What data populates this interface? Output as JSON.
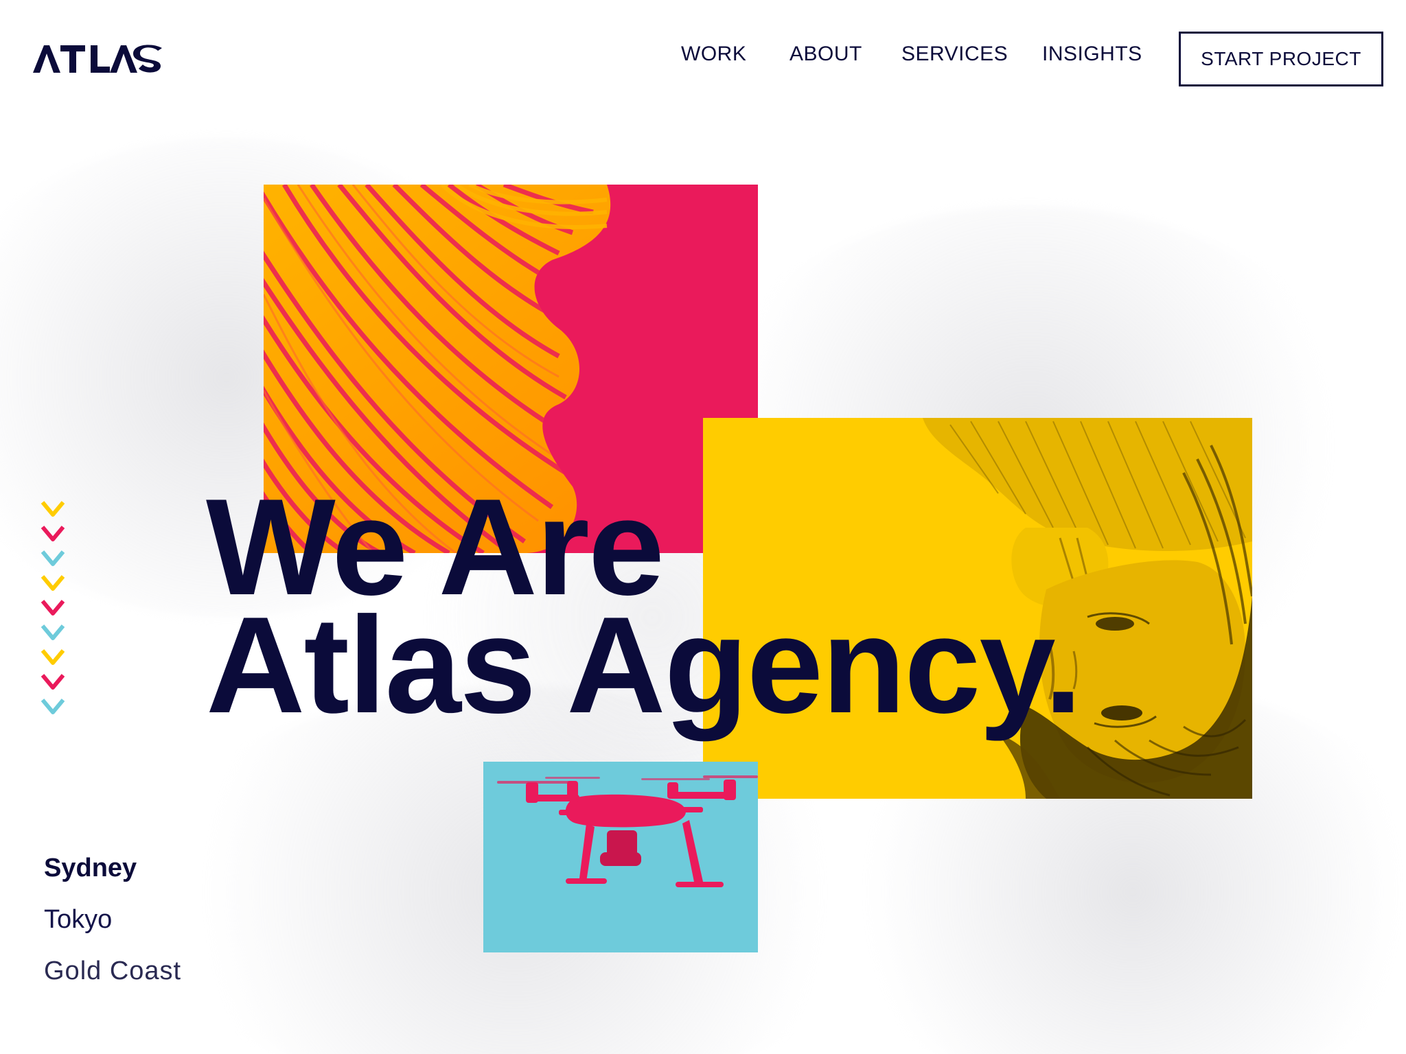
{
  "brand": {
    "logo_text": "ATLAS"
  },
  "nav": {
    "items": [
      {
        "label": "WORK"
      },
      {
        "label": "ABOUT"
      },
      {
        "label": "SERVICES"
      },
      {
        "label": "INSIGHTS"
      }
    ],
    "cta_label": "START PROJECT"
  },
  "hero": {
    "line1": "We Are",
    "line2": "Atlas Agency."
  },
  "locations": [
    {
      "name": "Sydney"
    },
    {
      "name": "Tokyo"
    },
    {
      "name": "Gold Coast"
    }
  ],
  "decor": {
    "chevron_colors": [
      "#ffcc00",
      "#ea1a5b",
      "#6ecbdb",
      "#ffcc00",
      "#ea1a5b",
      "#6ecbdb",
      "#ffcc00",
      "#ea1a5b",
      "#6ecbdb"
    ]
  },
  "colors": {
    "navy": "#0b0b3a",
    "pink": "#ea1a5b",
    "yellow": "#ffcc00",
    "cyan": "#6ecbdb"
  },
  "images": [
    {
      "name": "spiral-staircase-photo"
    },
    {
      "name": "upside-down-woman-photo"
    },
    {
      "name": "drone-photo"
    }
  ]
}
